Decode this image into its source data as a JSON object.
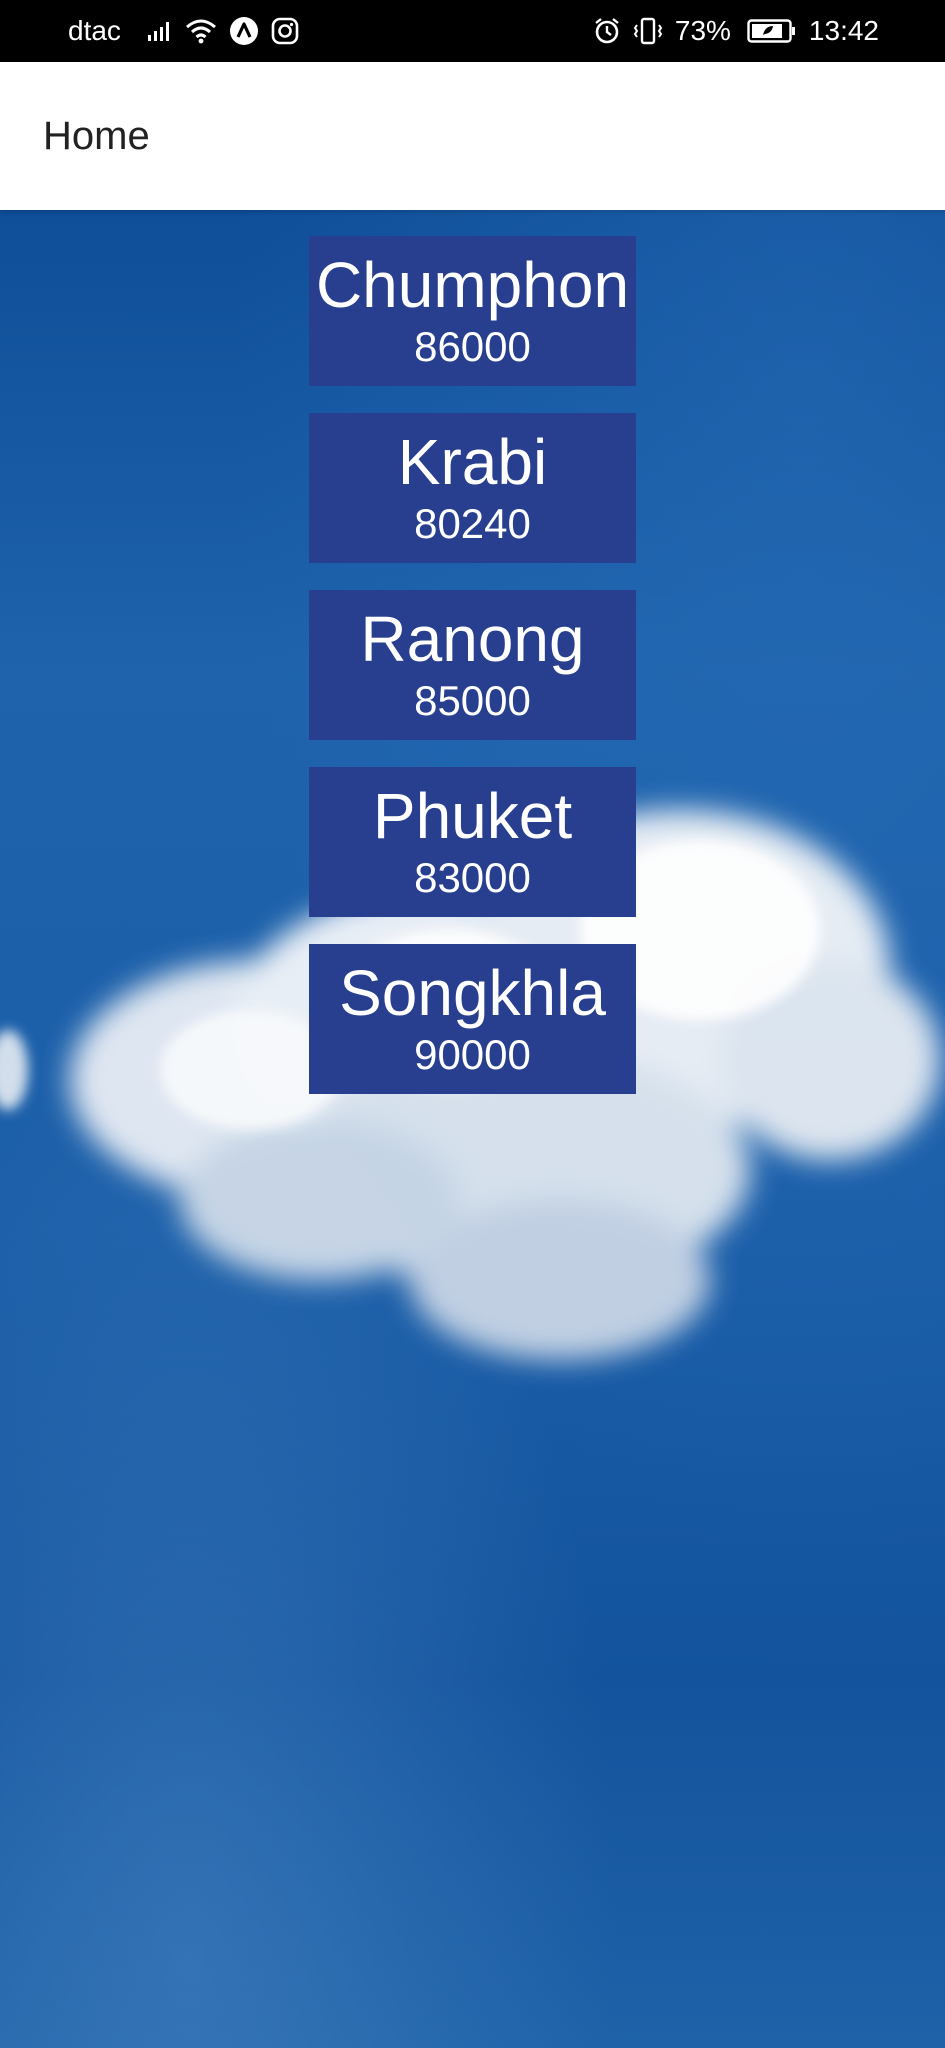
{
  "status_bar": {
    "carrier": "dtac",
    "battery_percent": "73%",
    "time": "13:42",
    "left_icons": [
      "signal-icon",
      "wifi-icon",
      "app-a-icon",
      "instagram-icon"
    ],
    "right_icons": [
      "alarm-icon",
      "vibrate-icon",
      "battery-icon"
    ]
  },
  "app_bar": {
    "title": "Home"
  },
  "provinces": [
    {
      "name": "Chumphon",
      "zip": "86000"
    },
    {
      "name": "Krabi",
      "zip": "80240"
    },
    {
      "name": "Ranong",
      "zip": "85000"
    },
    {
      "name": "Phuket",
      "zip": "83000"
    },
    {
      "name": "Songkhla",
      "zip": "90000"
    }
  ],
  "colors": {
    "card_background": "#273f8e",
    "sky": "#1b5ea8",
    "app_bar": "#ffffff",
    "status_bar": "#000000"
  }
}
